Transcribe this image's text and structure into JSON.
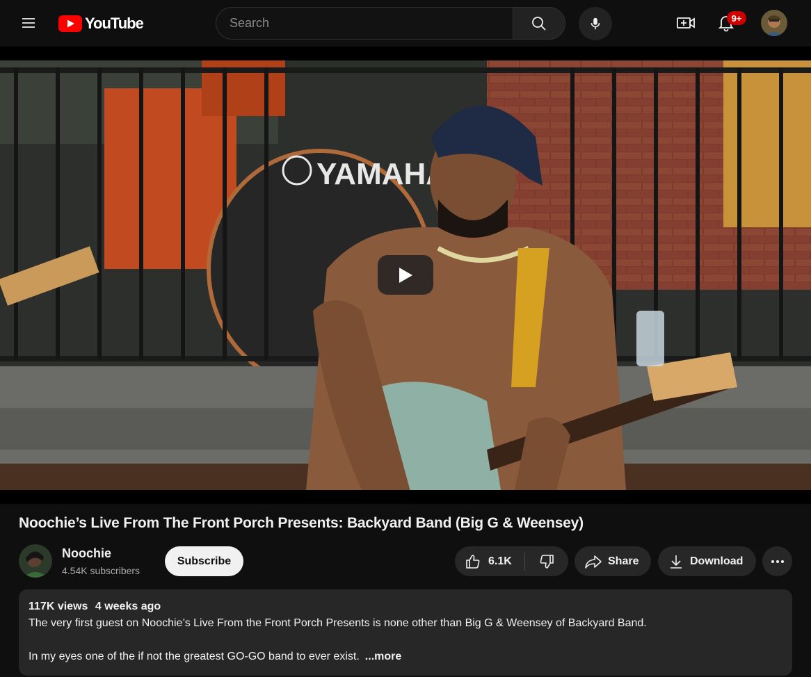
{
  "header": {
    "logo_text": "YouTube",
    "search_placeholder": "Search",
    "notification_count": "9+"
  },
  "video": {
    "title": "Noochie’s Live From The Front Porch Presents: Backyard Band (Big G & Weensey)",
    "drum_brand": "YAMAHA"
  },
  "channel": {
    "name": "Noochie",
    "subscribers": "4.54K subscribers",
    "subscribe_label": "Subscribe"
  },
  "actions": {
    "likes": "6.1K",
    "share_label": "Share",
    "download_label": "Download"
  },
  "description": {
    "views": "117K views",
    "age": "4 weeks ago",
    "line1": "The very first guest on Noochie’s Live From the Front Porch Presents is none other than Big G & Weensey of Backyard Band.",
    "line2": "In my eyes one of the if not the greatest GO-GO band to ever exist.",
    "more_label": "...more"
  },
  "colors": {
    "background": "#0f0f0f",
    "brand_red": "#ff0000",
    "badge_red": "#cc0000",
    "pill": "#272727"
  }
}
